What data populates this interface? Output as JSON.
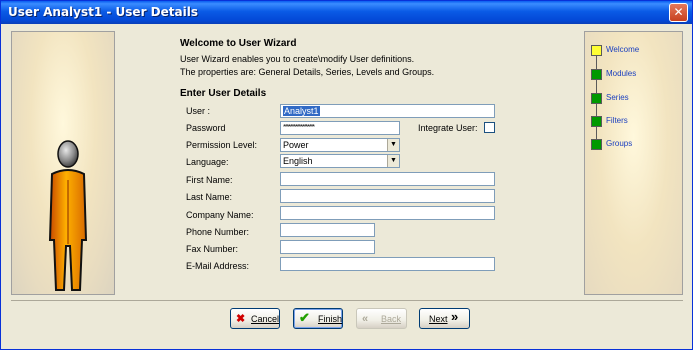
{
  "window": {
    "title": "User Analyst1 - User Details",
    "close_glyph": "✕"
  },
  "wizard": {
    "heading": "Welcome to User Wizard",
    "desc_line1": "User Wizard enables you to create\\modify User definitions.",
    "desc_line2": "The properties are: General Details, Series, Levels and Groups.",
    "section_title": "Enter User Details"
  },
  "form": {
    "user_label": "User :",
    "user_value": "Analyst1",
    "password_label": "Password",
    "password_value": "******************",
    "integrate_label": "Integrate User:",
    "integrate_checked": false,
    "permission_label": "Permission Level:",
    "permission_value": "Power",
    "language_label": "Language:",
    "language_value": "English",
    "first_name_label": "First Name:",
    "first_name_value": "",
    "last_name_label": "Last Name:",
    "last_name_value": "",
    "company_label": "Company Name:",
    "company_value": "",
    "phone_label": "Phone Number:",
    "phone_value": "",
    "fax_label": "Fax Number:",
    "fax_value": "",
    "email_label": "E-Mail Address:",
    "email_value": ""
  },
  "steps": [
    {
      "label": "Welcome",
      "color": "#ffff33"
    },
    {
      "label": "Modules",
      "color": "#009900"
    },
    {
      "label": "Series",
      "color": "#009900"
    },
    {
      "label": "Filters",
      "color": "#009900"
    },
    {
      "label": "Groups",
      "color": "#009900"
    }
  ],
  "buttons": {
    "cancel": "Cancel",
    "finish": "Finish",
    "back": "Back",
    "next": "Next"
  },
  "icons": {
    "cancel": "x-icon",
    "finish": "checkmark-icon",
    "back": "double-left-arrow-icon",
    "next": "double-right-arrow-icon",
    "dropdown": "chevron-down-icon",
    "figure": "user-figure-icon"
  }
}
